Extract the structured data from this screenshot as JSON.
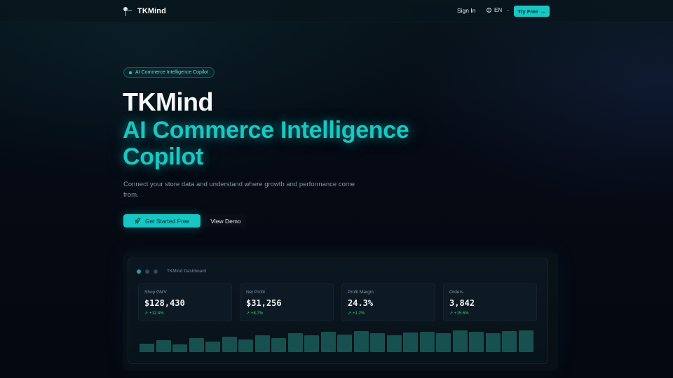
{
  "header": {
    "brand": "TKMind",
    "signin": "Sign In",
    "lang": "EN",
    "try_label": "Try Free",
    "icons": {
      "logo": "tkmind-logo",
      "globe": "globe-icon",
      "chevron": "chevron-down-icon",
      "arrow": "arrow-right-icon"
    }
  },
  "hero": {
    "pill": "AI Commerce Intelligence Copilot",
    "title": "TKMind",
    "subtitle": "AI Commerce Intelligence Copilot",
    "description": "Connect your store data and understand where growth and performance come from.",
    "cta_primary": "Get Started Free",
    "cta_secondary": "View Demo"
  },
  "dashboard": {
    "title": "TKMind Dashboard",
    "cards": [
      {
        "label": "Shop GMV",
        "value": "$128,430",
        "delta": "+12.4%"
      },
      {
        "label": "Net Profit",
        "value": "$31,256",
        "delta": "+8.7%"
      },
      {
        "label": "Profit Margin",
        "value": "24.3%",
        "delta": "+1.2%"
      },
      {
        "label": "Orders",
        "value": "3,842",
        "delta": "+15.6%"
      }
    ],
    "bar_levels": [
      0.35,
      0.5,
      0.32,
      0.58,
      0.45,
      0.66,
      0.52,
      0.72,
      0.6,
      0.78,
      0.7,
      0.84,
      0.74,
      0.88,
      0.8,
      0.72,
      0.82,
      0.86,
      0.78,
      0.9,
      0.84,
      0.8,
      0.88,
      0.92
    ],
    "colors": {
      "accent": "#17c7c3",
      "positive": "#2ecf7a",
      "bar": "#17514f"
    }
  }
}
